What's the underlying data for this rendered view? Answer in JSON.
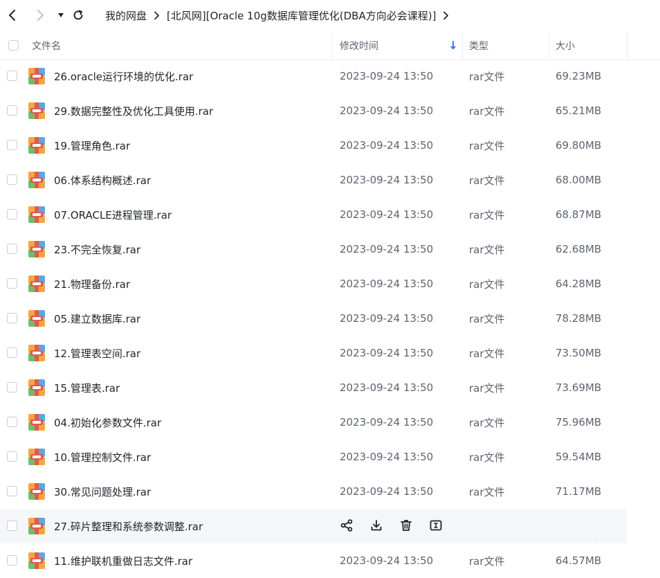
{
  "nav": {
    "crumbs": [
      "我的网盘",
      "[北风网][Oracle 10g数据库管理优化(DBA方向必会课程)]"
    ]
  },
  "table": {
    "headers": {
      "name": "文件名",
      "modified": "修改时间",
      "type": "类型",
      "size": "大小"
    },
    "sort_icon": "arrow-down-icon",
    "rows": [
      {
        "name": "26.oracle运行环境的优化.rar",
        "modified": "2023-09-24 13:50",
        "type": "rar文件",
        "size": "69.23MB"
      },
      {
        "name": "29.数据完整性及优化工具使用.rar",
        "modified": "2023-09-24 13:50",
        "type": "rar文件",
        "size": "65.21MB"
      },
      {
        "name": "19.管理角色.rar",
        "modified": "2023-09-24 13:50",
        "type": "rar文件",
        "size": "69.80MB"
      },
      {
        "name": "06.体系结构概述.rar",
        "modified": "2023-09-24 13:50",
        "type": "rar文件",
        "size": "68.00MB"
      },
      {
        "name": "07.ORACLE进程管理.rar",
        "modified": "2023-09-24 13:50",
        "type": "rar文件",
        "size": "68.87MB"
      },
      {
        "name": "23.不完全恢复.rar",
        "modified": "2023-09-24 13:50",
        "type": "rar文件",
        "size": "62.68MB"
      },
      {
        "name": "21.物理备份.rar",
        "modified": "2023-09-24 13:50",
        "type": "rar文件",
        "size": "64.28MB"
      },
      {
        "name": "05.建立数据库.rar",
        "modified": "2023-09-24 13:50",
        "type": "rar文件",
        "size": "78.28MB"
      },
      {
        "name": "12.管理表空间.rar",
        "modified": "2023-09-24 13:50",
        "type": "rar文件",
        "size": "73.50MB"
      },
      {
        "name": "15.管理表.rar",
        "modified": "2023-09-24 13:50",
        "type": "rar文件",
        "size": "73.69MB"
      },
      {
        "name": "04.初始化参数文件.rar",
        "modified": "2023-09-24 13:50",
        "type": "rar文件",
        "size": "75.96MB"
      },
      {
        "name": "10.管理控制文件.rar",
        "modified": "2023-09-24 13:50",
        "type": "rar文件",
        "size": "59.54MB"
      },
      {
        "name": "30.常见问题处理.rar",
        "modified": "2023-09-24 13:50",
        "type": "rar文件",
        "size": "71.17MB"
      },
      {
        "name": "27.碎片整理和系统参数调整.rar",
        "hover": true,
        "actions": [
          "share-icon",
          "download-icon",
          "delete-icon",
          "rename-icon"
        ]
      },
      {
        "name": "11.维护联机重做日志文件.rar",
        "modified": "2023-09-24 13:50",
        "type": "rar文件",
        "size": "64.57MB"
      }
    ]
  },
  "colors": {
    "accent": "#2f80ed",
    "text": "#1f2329",
    "muted": "#5c6370",
    "hover": "#f5f6f8"
  }
}
